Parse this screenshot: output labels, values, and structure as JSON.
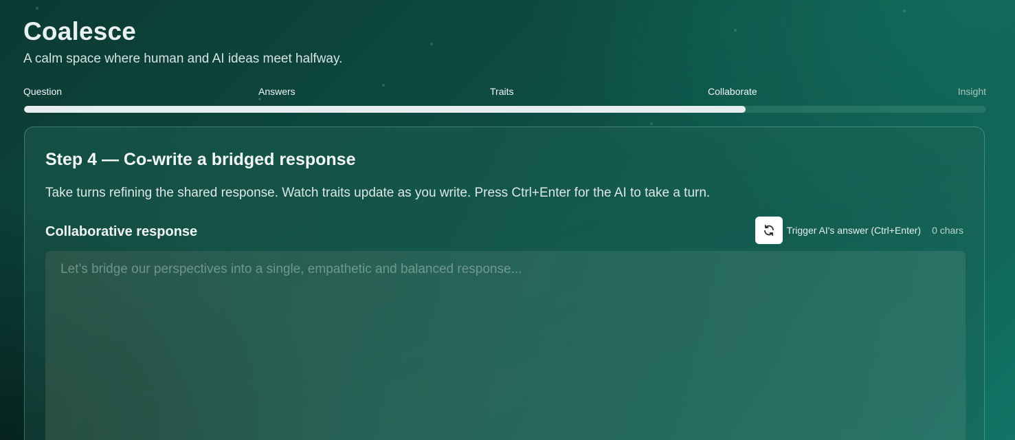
{
  "app": {
    "title": "Coalesce",
    "subtitle": "A calm space where human and AI ideas meet halfway."
  },
  "steps": [
    {
      "label": "Question",
      "status": "complete"
    },
    {
      "label": "Answers",
      "status": "complete"
    },
    {
      "label": "Traits",
      "status": "complete"
    },
    {
      "label": "Collaborate",
      "status": "current"
    },
    {
      "label": "Insight",
      "status": "pending"
    }
  ],
  "progress": {
    "fraction": 0.75
  },
  "card": {
    "title": "Step 4 — Co-write a bridged response",
    "description": "Take turns refining the shared response. Watch traits update as you write. Press Ctrl+Enter for the AI to take a turn.",
    "field_label": "Collaborative response",
    "trigger_icon": "refresh-icon",
    "trigger_label": "Trigger AI's answer (Ctrl+Enter)",
    "char_count": "0 chars",
    "textarea_value": "",
    "textarea_placeholder": "Let’s bridge our perspectives into a single, empathetic and balanced response..."
  },
  "colors": {
    "background_start": "#0b3a33",
    "background_end": "#117466",
    "progress_fill": "#e6eef0",
    "trigger_button_bg": "#ffffff"
  }
}
